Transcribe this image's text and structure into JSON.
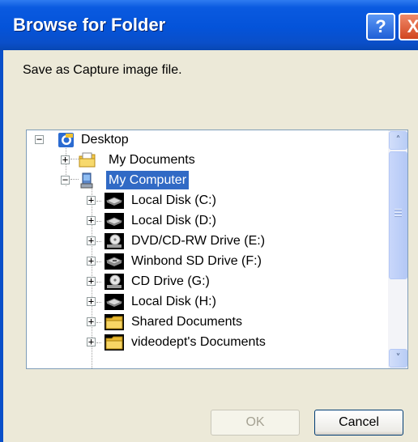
{
  "window": {
    "title": "Browse for Folder",
    "help_glyph": "?",
    "close_glyph": "X"
  },
  "description": "Save as Capture image file.",
  "tree": {
    "root": {
      "label": "Desktop",
      "icon": "desktop-icon",
      "expander": "−"
    },
    "items": [
      {
        "label": "My Documents",
        "icon": "my-documents-icon",
        "expander": "+"
      },
      {
        "label": "My Computer",
        "icon": "my-computer-icon",
        "expander": "−",
        "selected": true
      },
      {
        "label": "Local Disk (C:)",
        "icon": "hard-drive-icon",
        "expander": "+"
      },
      {
        "label": "Local Disk (D:)",
        "icon": "hard-drive-icon",
        "expander": "+"
      },
      {
        "label": "DVD/CD-RW Drive (E:)",
        "icon": "cd-drive-icon",
        "expander": "+"
      },
      {
        "label": "Winbond SD Drive (F:)",
        "icon": "removable-drive-icon",
        "expander": "+"
      },
      {
        "label": "CD Drive (G:)",
        "icon": "cd-drive-icon",
        "expander": "+"
      },
      {
        "label": "Local Disk (H:)",
        "icon": "hard-drive-icon",
        "expander": "+"
      },
      {
        "label": "Shared Documents",
        "icon": "folder-icon",
        "expander": "+"
      },
      {
        "label": "videodept's Documents",
        "icon": "folder-icon",
        "expander": "+"
      }
    ]
  },
  "scrollbar": {
    "up_glyph": "˄",
    "down_glyph": "˅"
  },
  "buttons": {
    "ok": "OK",
    "cancel": "Cancel"
  },
  "colors": {
    "selection": "#316ac5",
    "dialog_bg": "#ece9d8",
    "titlebar": "#0453d9"
  }
}
